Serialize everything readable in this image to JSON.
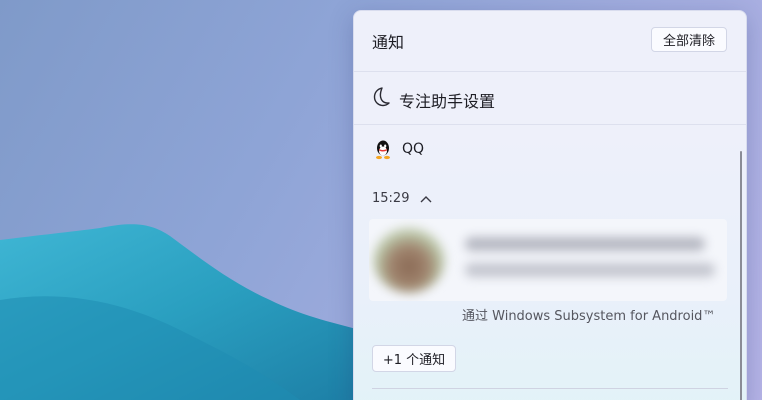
{
  "notification_center": {
    "title": "通知",
    "clear_all_label": "全部清除"
  },
  "focus_assist": {
    "icon": "moon-icon",
    "label": "专注助手设置"
  },
  "notification_group": {
    "app_icon": "qq-penguin-icon",
    "app_name": "QQ",
    "time": "15:29",
    "collapse_icon": "chevron-up-icon",
    "source_text": "通过 Windows Subsystem for Android™",
    "more_button_label": "+1 个通知"
  },
  "colors": {
    "panel_bg": "#eef0fa",
    "desktop_bg": "#8ea4d6",
    "wallpaper_fabric": "#2a9fc0"
  }
}
